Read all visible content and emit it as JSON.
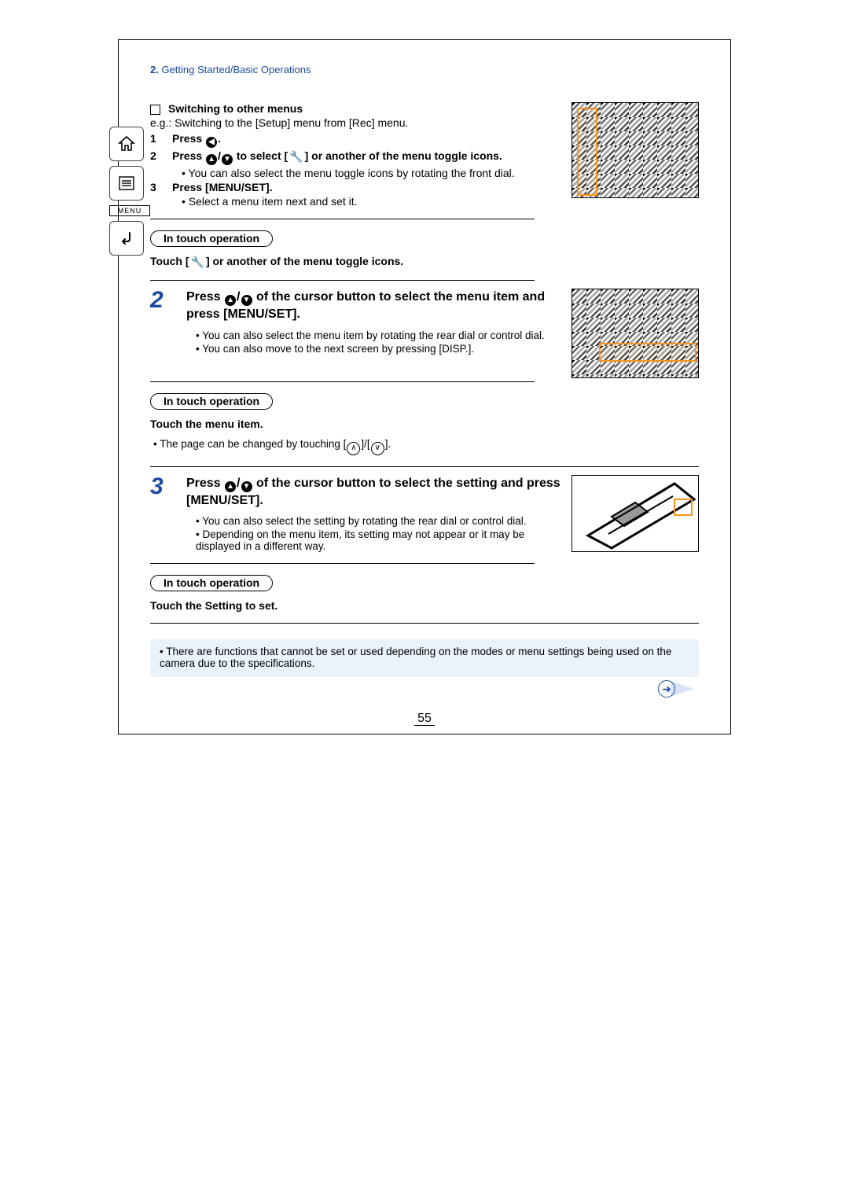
{
  "chapter": {
    "num": "2.",
    "title": "Getting Started/Basic Operations"
  },
  "sidebar": {
    "home_aria": "Home",
    "toc_aria": "Table of Contents",
    "menu_label": "MENU",
    "back_aria": "Back"
  },
  "switching": {
    "heading": "Switching to other menus",
    "example": "e.g.: Switching to the [Setup] menu from [Rec] menu.",
    "steps": {
      "s1": {
        "n": "1",
        "text_a": "Press ",
        "text_b": "."
      },
      "s2": {
        "n": "2",
        "text_a": "Press ",
        "text_b": " to select [",
        "text_c": "] or another of the menu toggle icons.",
        "bullet": "You can also select the menu toggle icons by rotating the front dial."
      },
      "s3": {
        "n": "3",
        "text": "Press [MENU/SET].",
        "bullet": "Select a menu item next and set it."
      }
    }
  },
  "touch_label": "In touch operation",
  "touch1": {
    "text_a": "Touch [",
    "text_b": "] or another of the menu toggle icons."
  },
  "step2": {
    "n": "2",
    "text_a": "Press ",
    "text_b": " of the cursor button to select the menu item and press [MENU/SET].",
    "bullets": [
      "You can also select the menu item by rotating the rear dial or control dial.",
      "You can also move to the next screen by pressing [DISP.]."
    ]
  },
  "touch2": {
    "heading": "Touch the menu item.",
    "bullet_a": "The page can be changed by touching [",
    "bullet_b": "]/[",
    "bullet_c": "]."
  },
  "step3": {
    "n": "3",
    "text_a": "Press ",
    "text_b": " of the cursor button to select the setting and press [MENU/SET].",
    "bullets": [
      "You can also select the setting by rotating the rear dial or control dial.",
      "Depending on the menu item, its setting may not appear or it may be displayed in a different way."
    ]
  },
  "touch3": {
    "heading": "Touch the Setting to set."
  },
  "note": "There are functions that cannot be set or used depending on the modes or menu settings being used on the camera due to the specifications.",
  "page_number": "55",
  "icons": {
    "wrench": "🔧",
    "left": "◀",
    "up": "▲",
    "down": "▼",
    "chev_up": "∧",
    "chev_down": "∨",
    "arrow_right": "➜"
  }
}
